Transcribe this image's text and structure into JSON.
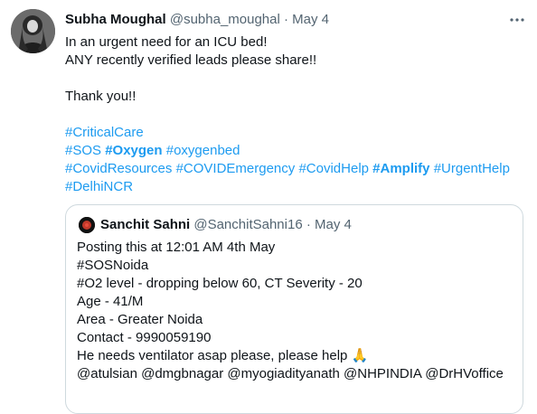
{
  "tweet": {
    "author_name": "Subha Moughal",
    "author_handle": "@subha_moughal",
    "separator": "·",
    "date": "May 4",
    "more_icon": "more-horizontal-icon",
    "text_line1": "In an urgent need for an ICU bed!",
    "text_line2": "ANY recently verified leads please share!!",
    "text_line3": "Thank you!!",
    "hashtags": {
      "critical_care": "#CriticalCare",
      "sos": "#SOS",
      "oxygen": "#Oxygen",
      "oxygenbed": "#oxygenbed",
      "covid_resources": "#CovidResources",
      "covid_emergency": "#COVIDEmergency",
      "covid_help": "#CovidHelp",
      "amplify": "#Amplify",
      "urgent_help": "#UrgentHelp",
      "delhi_ncr": "#DelhiNCR"
    }
  },
  "quote": {
    "author_name": "Sanchit Sahni",
    "author_handle": "@SanchitSahni16",
    "separator": "·",
    "date": "May 4",
    "lines": {
      "l1": "Posting this at 12:01 AM 4th May",
      "l2": "#SOSNoida",
      "l3": "#O2 level - dropping below 60, CT Severity - 20",
      "l4": "Age - 41/M",
      "l5": "Area - Greater Noida",
      "l6": "Contact - 9990059190",
      "l7": "He needs ventilator asap please, please help",
      "l8": "@atulsian  @dmgbnagar @myogiadityanath @NHPINDIA @DrHVoffice"
    },
    "pray_emoji": "🙏"
  },
  "colors": {
    "link": "#1d9bf0",
    "text": "#0f1419",
    "muted": "#536471",
    "border": "#cfd9de"
  }
}
